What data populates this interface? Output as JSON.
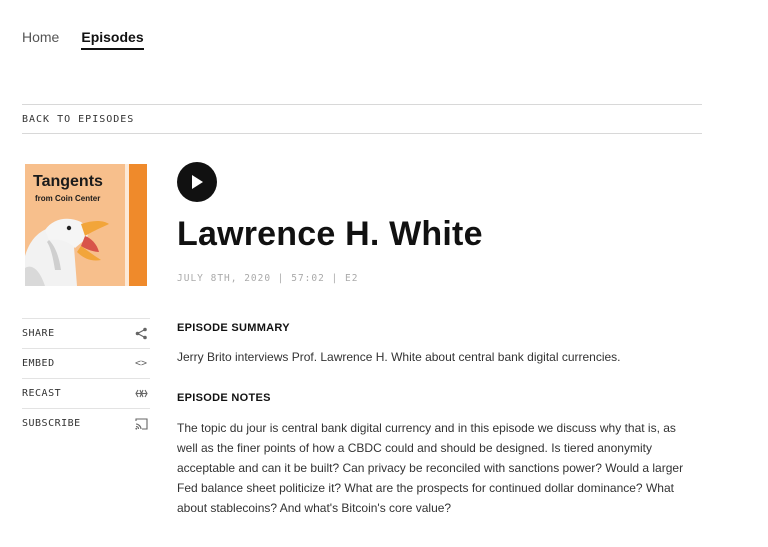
{
  "nav": {
    "home": "Home",
    "episodes": "Episodes"
  },
  "back_label": "BACK TO EPISODES",
  "cover": {
    "title": "Tangents",
    "subtitle": "from Coin Center"
  },
  "side_actions": [
    {
      "label": "SHARE",
      "icon": "share-icon"
    },
    {
      "label": "EMBED",
      "icon": "embed-icon",
      "glyph": "<>"
    },
    {
      "label": "RECAST",
      "icon": "recast-icon"
    },
    {
      "label": "SUBSCRIBE",
      "icon": "cast-icon"
    }
  ],
  "episode": {
    "title": "Lawrence H. White",
    "meta": "JULY 8TH, 2020 | 57:02 | E2",
    "summary_heading": "EPISODE SUMMARY",
    "summary": "Jerry Brito interviews Prof. Lawrence H. White about central bank digital currencies.",
    "notes_heading": "EPISODE NOTES",
    "notes": "The topic du jour is central bank digital currency and in this episode we discuss why that is, as well as the finer points of how a CBDC could and should be designed. Is tiered anonymity acceptable and can it be built? Can privacy be reconciled with sanctions power? Would a larger Fed balance sheet politicize it? What are the prospects for continued dollar dominance? What about stablecoins? And what's Bitcoin's core value?"
  },
  "colors": {
    "cover_bg": "#f7bf8c",
    "cover_stripe": "#ef8a2b",
    "text": "#111111",
    "muted": "#aaaaaa"
  }
}
